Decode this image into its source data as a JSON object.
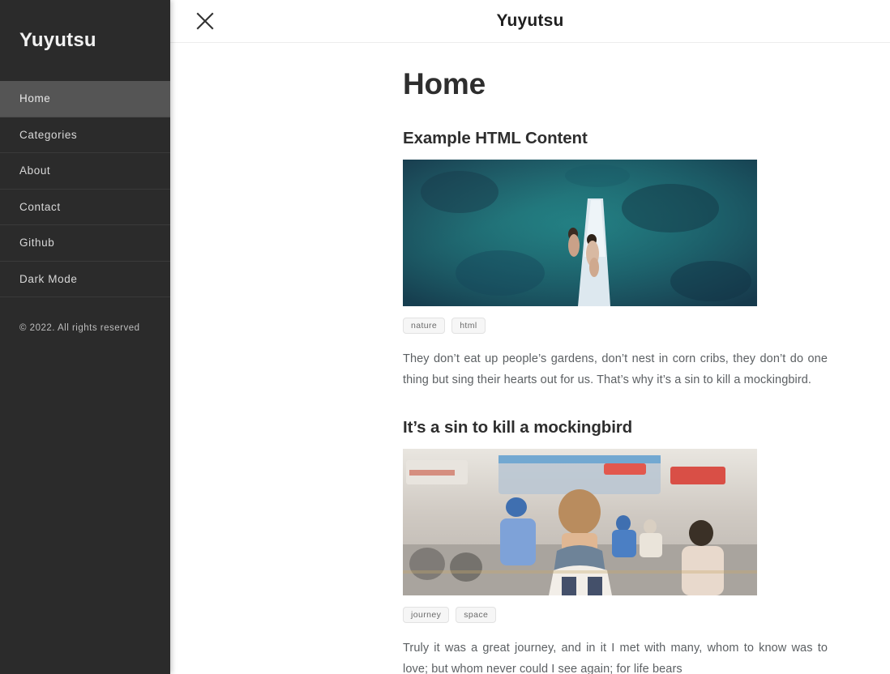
{
  "sidebar": {
    "brand": "Yuyutsu",
    "items": [
      {
        "label": "Home",
        "active": true
      },
      {
        "label": "Categories",
        "active": false
      },
      {
        "label": "About",
        "active": false
      },
      {
        "label": "Contact",
        "active": false
      },
      {
        "label": "Github",
        "active": false
      },
      {
        "label": "Dark Mode",
        "active": false
      }
    ],
    "footer": "© 2022. All rights reserved",
    "bg_color": "#2b2b2b",
    "active_bg_color": "#555555"
  },
  "topbar": {
    "title": "Yuyutsu",
    "close_icon": "close-icon"
  },
  "main": {
    "page_title": "Home",
    "posts": [
      {
        "title": "Example HTML Content",
        "image_alt": "aerial-boat-on-turquoise-water",
        "tags": [
          "nature",
          "html"
        ],
        "body": "They don’t eat up people’s gardens, don’t nest in corn cribs, they don’t do one thing but sing their hearts out for us. That’s why it’s a sin to kill a mockingbird."
      },
      {
        "title": "It’s a sin to kill a mockingbird",
        "image_alt": "traveler-walking-on-busy-street",
        "tags": [
          "journey",
          "space"
        ],
        "body": "Truly it was a great journey, and in it I met with many, whom to know was to love; but whom never could I see again; for life bears"
      }
    ]
  }
}
